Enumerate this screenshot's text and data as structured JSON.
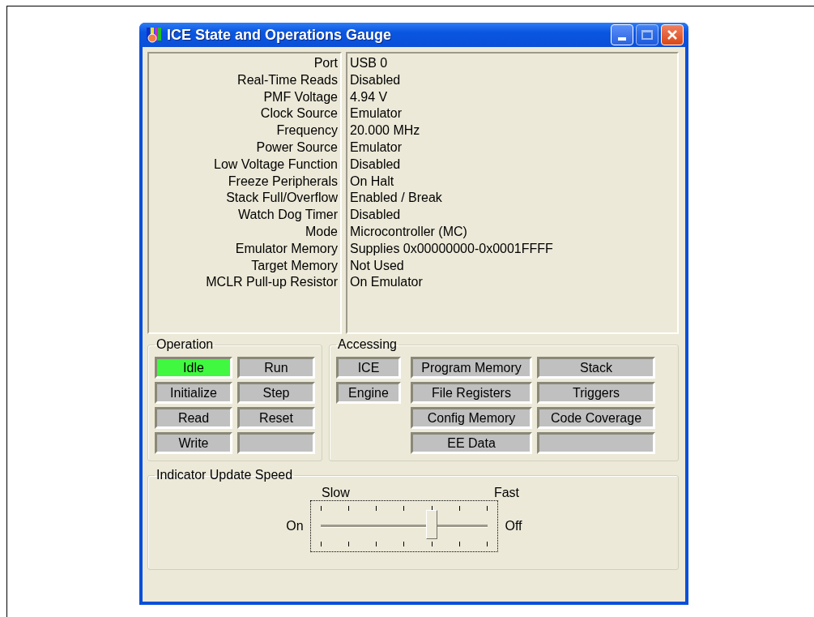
{
  "window": {
    "title": "ICE State and Operations Gauge"
  },
  "info": [
    {
      "label": "Port",
      "value": "USB 0"
    },
    {
      "label": "Real-Time Reads",
      "value": "Disabled"
    },
    {
      "label": "PMF Voltage",
      "value": "4.94 V"
    },
    {
      "label": "Clock Source",
      "value": "Emulator"
    },
    {
      "label": "Frequency",
      "value": "20.000 MHz"
    },
    {
      "label": "Power Source",
      "value": "Emulator"
    },
    {
      "label": "Low Voltage Function",
      "value": "Disabled"
    },
    {
      "label": "Freeze Peripherals",
      "value": "On Halt"
    },
    {
      "label": "Stack Full/Overflow",
      "value": "Enabled / Break"
    },
    {
      "label": "Watch Dog Timer",
      "value": "Disabled"
    },
    {
      "label": "Mode",
      "value": "Microcontroller (MC)"
    },
    {
      "label": "Emulator Memory",
      "value": "Supplies 0x00000000-0x0001FFFF"
    },
    {
      "label": "Target Memory",
      "value": "Not Used"
    },
    {
      "label": "MCLR Pull-up Resistor",
      "value": "On Emulator"
    }
  ],
  "operation": {
    "title": "Operation",
    "indicators": [
      {
        "kind": "indicator",
        "label": "Idle",
        "on": true
      },
      {
        "kind": "indicator",
        "label": "Run",
        "on": false
      },
      {
        "kind": "indicator",
        "label": "Initialize",
        "on": false
      },
      {
        "kind": "indicator",
        "label": "Step",
        "on": false
      },
      {
        "kind": "indicator",
        "label": "Read",
        "on": false
      },
      {
        "kind": "indicator",
        "label": "Reset",
        "on": false
      },
      {
        "kind": "indicator",
        "label": "Write",
        "on": false
      },
      {
        "kind": "blank"
      }
    ]
  },
  "accessing": {
    "title": "Accessing",
    "devices": [
      {
        "kind": "indicator",
        "label": "ICE",
        "on": false
      },
      {
        "kind": "indicator",
        "label": "Engine",
        "on": false
      }
    ],
    "areas": [
      {
        "kind": "indicator",
        "label": "Program Memory",
        "on": false
      },
      {
        "kind": "indicator",
        "label": "Stack",
        "on": false
      },
      {
        "kind": "indicator",
        "label": "File Registers",
        "on": false
      },
      {
        "kind": "indicator",
        "label": "Triggers",
        "on": false
      },
      {
        "kind": "indicator",
        "label": "Config Memory",
        "on": false
      },
      {
        "kind": "indicator",
        "label": "Code Coverage",
        "on": false
      },
      {
        "kind": "indicator",
        "label": "EE Data",
        "on": false
      },
      {
        "kind": "blank"
      }
    ]
  },
  "speed": {
    "title": "Indicator Update Speed",
    "slow_label": "Slow",
    "fast_label": "Fast",
    "left_label": "On",
    "right_label": "Off",
    "level": 0.667
  }
}
